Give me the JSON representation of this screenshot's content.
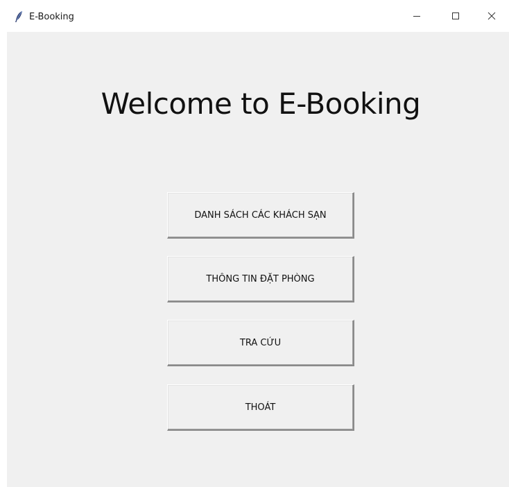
{
  "window": {
    "title": "E-Booking",
    "app_icon": "feather-icon",
    "controls": {
      "minimize_icon": "minimize-icon",
      "maximize_icon": "maximize-icon",
      "close_icon": "close-icon"
    }
  },
  "main": {
    "heading": "Welcome to E-Booking",
    "buttons": [
      {
        "label": "DANH SÁCH CÁC KHÁCH SẠN"
      },
      {
        "label": "THÔNG TIN ĐẶT PHÒNG"
      },
      {
        "label": "TRA CỨU"
      },
      {
        "label": "THOÁT"
      }
    ]
  },
  "colors": {
    "client_background": "#f0f0f0",
    "titlebar_background": "#ffffff",
    "text": "#111111"
  }
}
